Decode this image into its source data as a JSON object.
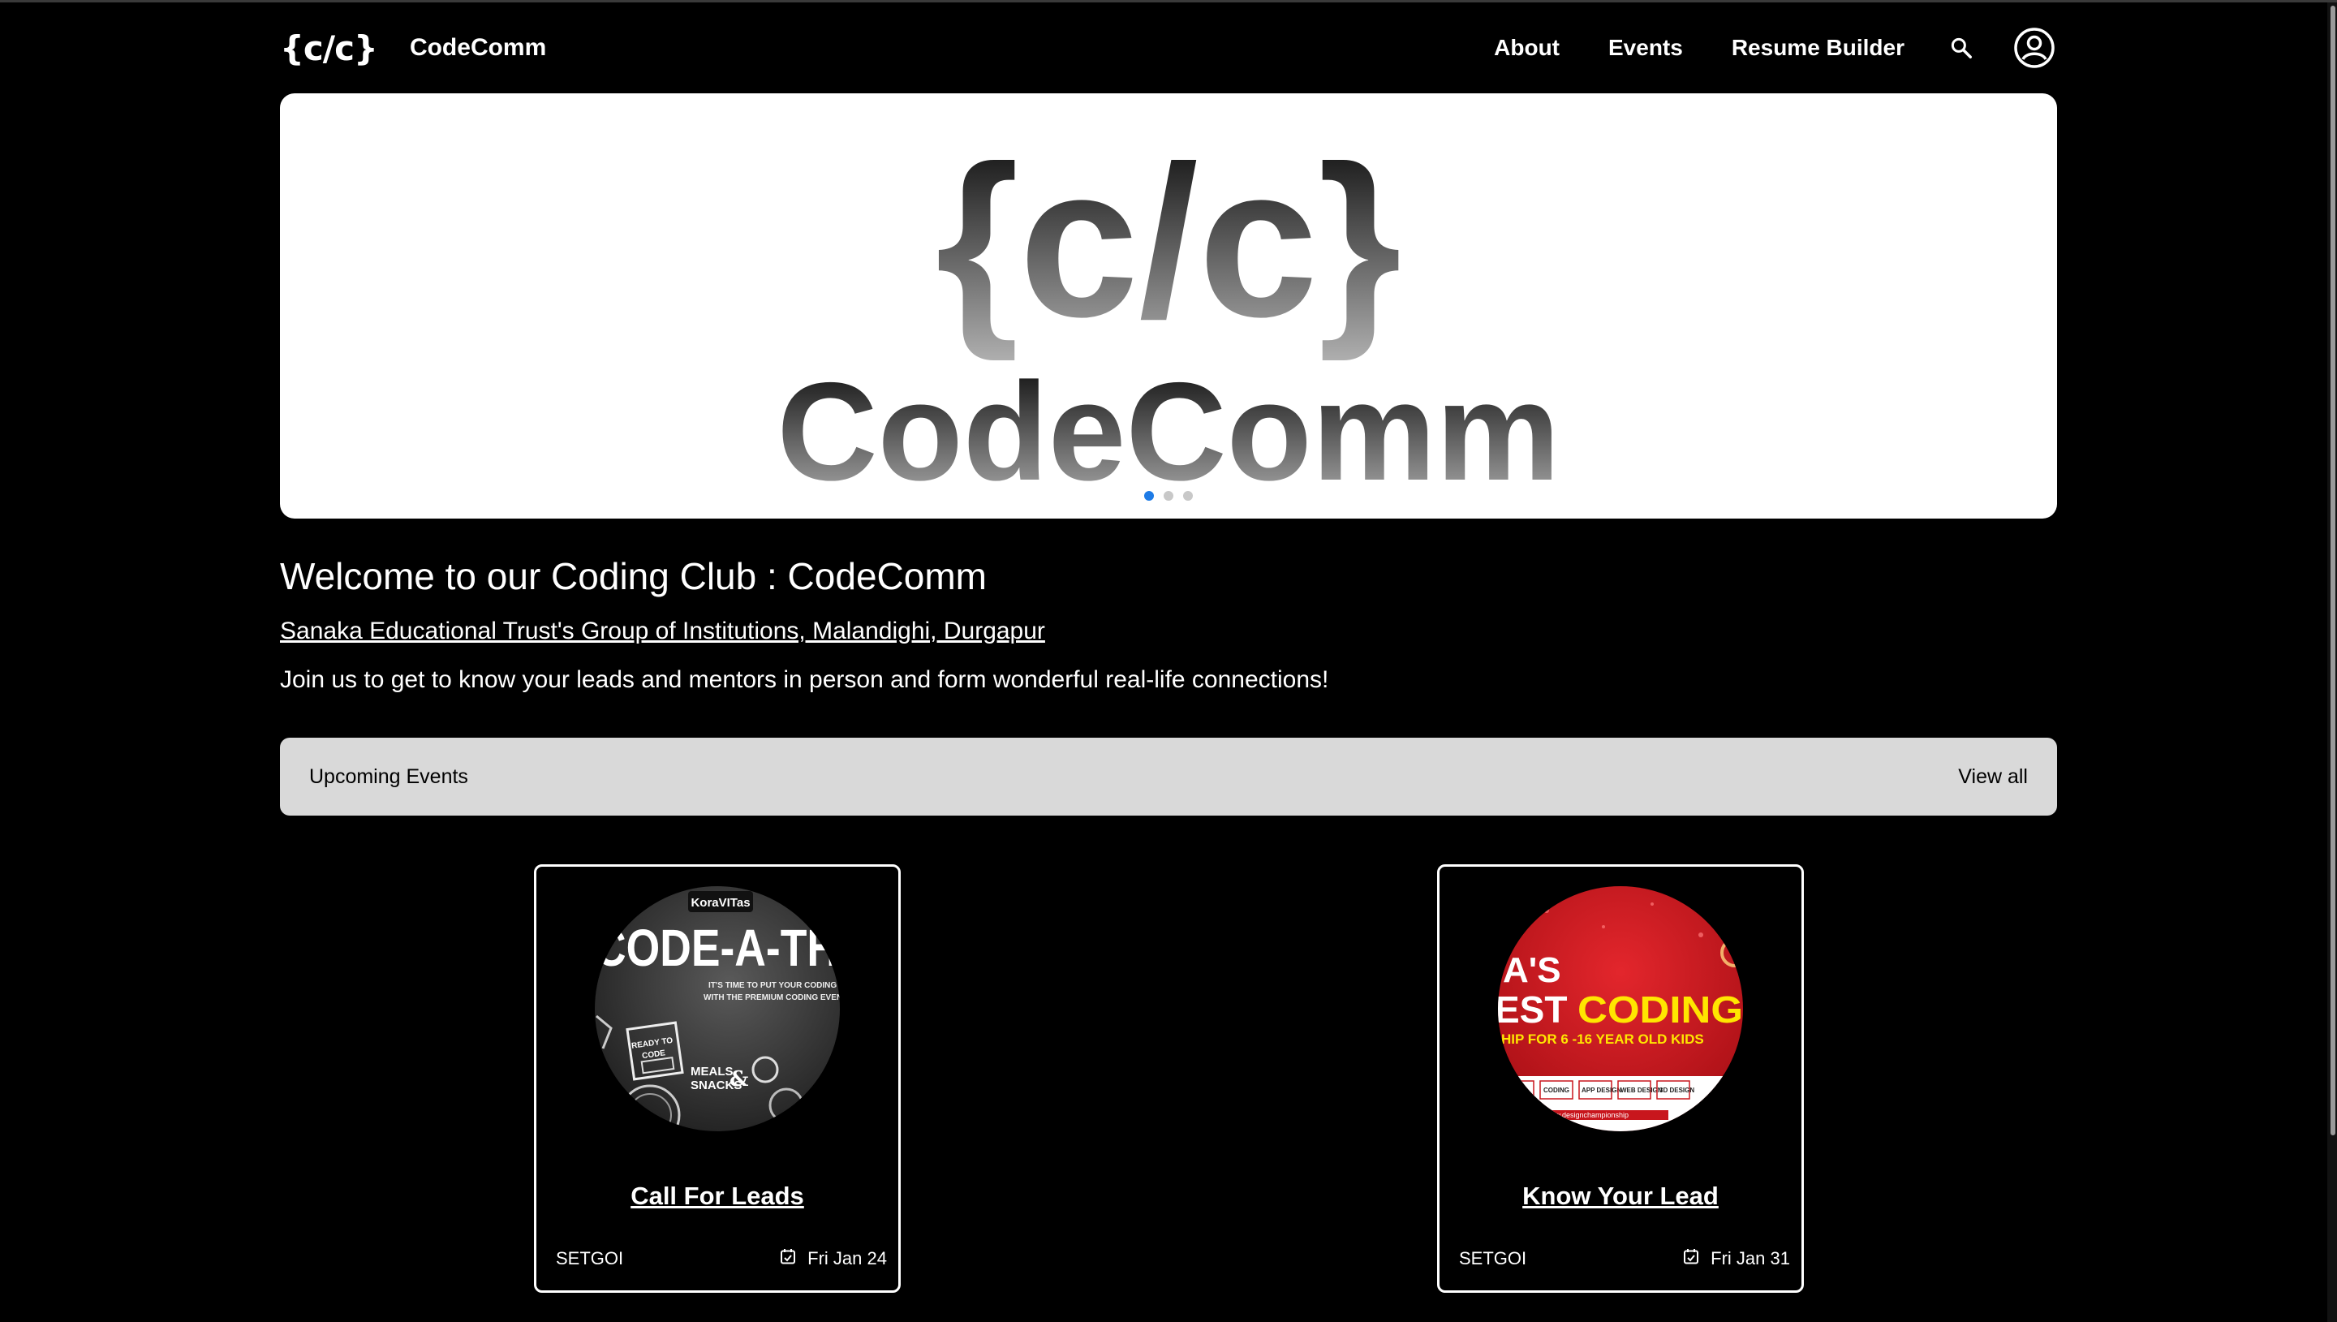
{
  "header": {
    "logo": "{c/c}",
    "brand": "CodeComm",
    "nav": [
      "About",
      "Events",
      "Resume Builder"
    ],
    "search_icon": "search-icon",
    "account_icon": "account-circle-icon"
  },
  "hero": {
    "logo": "{c/c}",
    "name": "CodeComm",
    "slides_total": 3,
    "active_slide": 1
  },
  "welcome": {
    "title": "Welcome to our Coding Club : CodeComm",
    "institution": "Sanaka Educational Trust's Group of Institutions, Malandighi, Durgapur",
    "description": "Join us to get to know your leads and mentors in person and form wonderful real-life connections!"
  },
  "events_bar": {
    "title": "Upcoming Events",
    "view_all": "View all"
  },
  "events": [
    {
      "title": "Call For Leads",
      "org": "SETGOI",
      "date": "Fri Jan 24",
      "poster": {
        "sponsor": "KoraVITas",
        "headline": "CODE-A-TH",
        "tagline_1": "IT'S TIME TO PUT YOUR CODING SI",
        "tagline_2": "WITH THE PREMIUM CODING EVENT",
        "badge_1": "READY TO",
        "badge_2": "CODE",
        "perk_1": "MEALS",
        "perk_2": "SNACKS",
        "perk_amp": "&"
      }
    },
    {
      "title": "Know Your Lead",
      "org": "SETGOI",
      "date": "Fri Jan 31",
      "poster": {
        "line_1": "A'S",
        "line_2a": "EST",
        "line_2b": "CODING",
        "line_3": "HIP FOR 6 -16 YEAR OLD KIDS",
        "chips": [
          "APHIC",
          "CODING",
          "APP DESIGN",
          "WEB DESIGN",
          "3D DESIGN"
        ],
        "url": "ww.designchampionship"
      }
    }
  ],
  "colors": {
    "background": "#000000",
    "events_bar": "#d9d9d9",
    "active_dot": "#1e7be6",
    "poster_2_red": "#c8161d",
    "poster_2_yellow": "#ffe600"
  }
}
